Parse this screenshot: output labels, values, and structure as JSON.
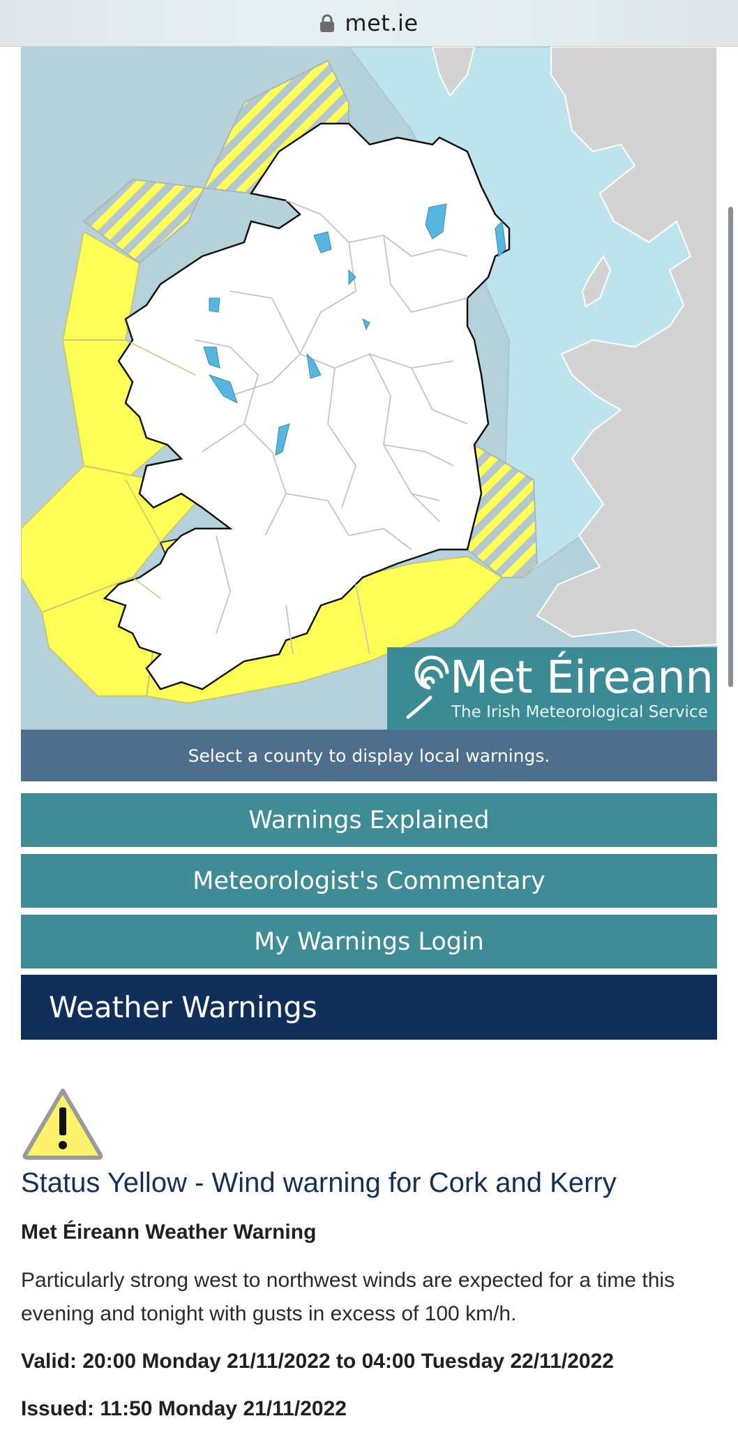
{
  "browser": {
    "domain": "met.ie"
  },
  "map": {
    "colors": {
      "sea": "#b5d1dc",
      "sea_zone": "#bde3ef",
      "land": "#ffffff",
      "foreign_land": "#d3d3d3",
      "warning_yellow": "#ffff55",
      "hatch_grey": "#b3c7cf",
      "lakes": "#57b6de"
    }
  },
  "logo": {
    "brand": "Met Éireann",
    "tagline": "The Irish Meteorological Service",
    "color": "#3b8b94"
  },
  "select_hint": "Select a county to display local warnings.",
  "buttons": {
    "warnings_explained": "Warnings Explained",
    "commentary": "Meteorologist's Commentary",
    "login": "My Warnings Login"
  },
  "section": {
    "title": "Weather Warnings"
  },
  "warning": {
    "title": "Status Yellow - Wind warning for Cork and Kerry",
    "source": "Met Éireann Weather Warning",
    "body": "Particularly strong west to northwest winds are expected for a time this evening and tonight with gusts in excess of 100 km/h.",
    "valid": "Valid: 20:00 Monday 21/11/2022 to 04:00 Tuesday 22/11/2022",
    "issued": "Issued: 11:50 Monday 21/11/2022"
  }
}
